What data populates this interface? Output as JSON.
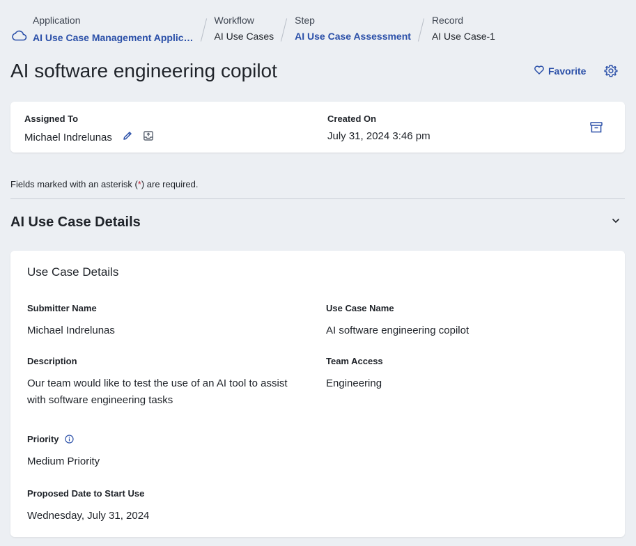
{
  "breadcrumb": [
    {
      "label": "Application",
      "value": "AI Use Case Management Applic…"
    },
    {
      "label": "Workflow",
      "value": "AI Use Cases"
    },
    {
      "label": "Step",
      "value": "AI Use Case Assessment"
    },
    {
      "label": "Record",
      "value": "AI Use Case-1"
    }
  ],
  "page": {
    "title": "AI software engineering copilot",
    "favorite_label": "Favorite"
  },
  "summary": {
    "assigned_to_label": "Assigned To",
    "assigned_to_value": "Michael Indrelunas",
    "created_on_label": "Created On",
    "created_on_value": "July 31, 2024 3:46 pm"
  },
  "required_note": {
    "before": "Fields marked with an asterisk (",
    "asterisk": "*",
    "after": ") are required."
  },
  "section": {
    "title": "AI Use Case Details",
    "card_title": "Use Case Details",
    "fields": {
      "submitter_name": {
        "label": "Submitter Name",
        "value": "Michael Indrelunas"
      },
      "use_case_name": {
        "label": "Use Case Name",
        "value": "AI software engineering copilot"
      },
      "description": {
        "label": "Description",
        "value": "Our team would like to test the use of an AI tool to assist with software engineering tasks"
      },
      "team_access": {
        "label": "Team Access",
        "value": "Engineering"
      },
      "priority": {
        "label": "Priority",
        "value": "Medium Priority"
      },
      "proposed_date": {
        "label": "Proposed Date to Start Use",
        "value": "Wednesday, July 31, 2024"
      }
    }
  },
  "colors": {
    "background": "#eceff3",
    "link": "#2a4fa8",
    "asterisk": "#c0283b"
  }
}
